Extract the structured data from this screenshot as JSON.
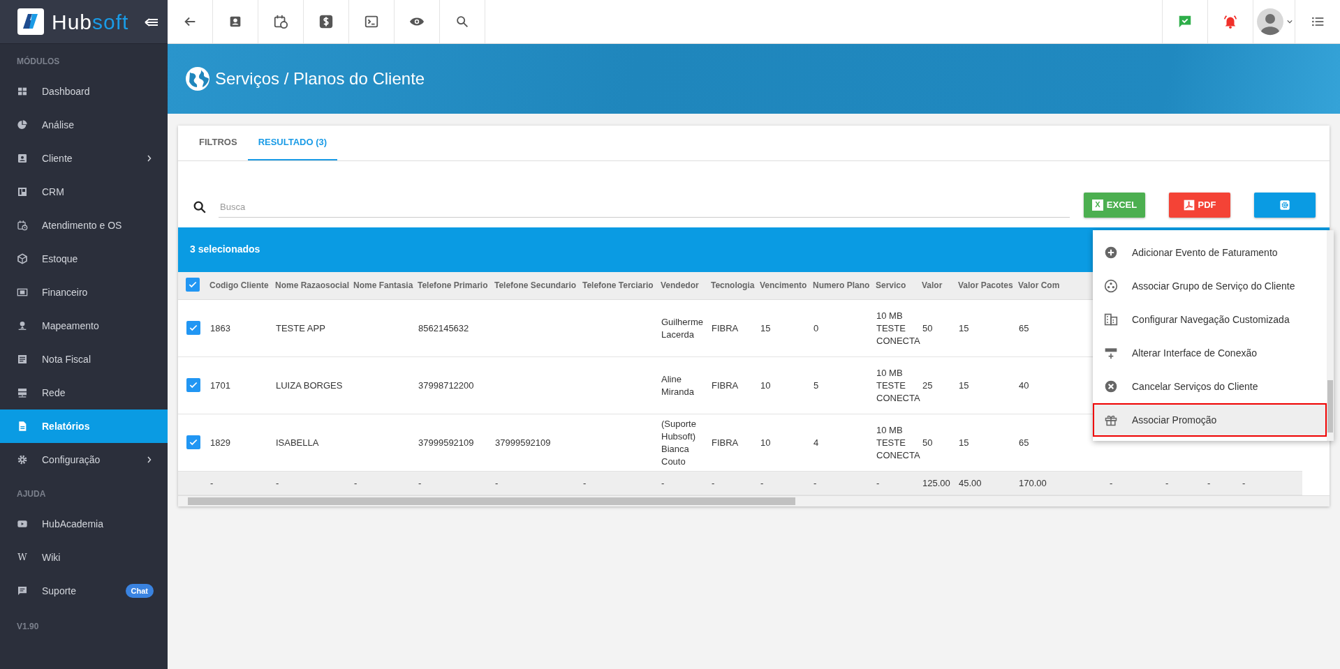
{
  "sidebar": {
    "logo": {
      "text_1": "Hub",
      "text_2": "soft"
    },
    "sections": [
      {
        "heading": "MÓDULOS",
        "items": [
          {
            "label": "Dashboard",
            "selected": false,
            "has_submenu": false
          },
          {
            "label": "Análise",
            "selected": false,
            "has_submenu": false
          },
          {
            "label": "Cliente",
            "selected": false,
            "has_submenu": true
          },
          {
            "label": "CRM",
            "selected": false,
            "has_submenu": false
          },
          {
            "label": "Atendimento e OS",
            "selected": false,
            "has_submenu": false
          },
          {
            "label": "Estoque",
            "selected": false,
            "has_submenu": false
          },
          {
            "label": "Financeiro",
            "selected": false,
            "has_submenu": false
          },
          {
            "label": "Mapeamento",
            "selected": false,
            "has_submenu": false
          },
          {
            "label": "Nota Fiscal",
            "selected": false,
            "has_submenu": false
          },
          {
            "label": "Rede",
            "selected": false,
            "has_submenu": false
          },
          {
            "label": "Relatórios",
            "selected": true,
            "has_submenu": false
          },
          {
            "label": "Configuração",
            "selected": false,
            "has_submenu": true
          }
        ]
      },
      {
        "heading": "AJUDA",
        "items": [
          {
            "label": "HubAcademia",
            "selected": false,
            "has_submenu": false
          },
          {
            "label": "Wiki",
            "selected": false,
            "has_submenu": false,
            "icon_glyph": "W"
          },
          {
            "label": "Suporte",
            "selected": false,
            "has_submenu": false,
            "badge": "Chat"
          }
        ]
      }
    ],
    "version": "V1.90"
  },
  "page_header": {
    "title": "Serviços / Planos do Cliente"
  },
  "tabs": [
    {
      "label": "FILTROS",
      "selected": false
    },
    {
      "label": "RESULTADO (3)",
      "selected": true
    }
  ],
  "search": {
    "placeholder": "Busca"
  },
  "export_buttons": [
    {
      "kind": "excel",
      "label": "EXCEL",
      "icon_glyph": "X"
    },
    {
      "kind": "pdf",
      "label": "PDF"
    },
    {
      "kind": "settings"
    }
  ],
  "selection_bar": {
    "text": "3 selecionados"
  },
  "table": {
    "select_all_checked": true,
    "columns": [
      "Codigo Cliente",
      "Nome Razaosocial",
      "Nome Fantasia",
      "Telefone Primario",
      "Telefone Secundario",
      "Telefone Terciario",
      "Vendedor",
      "Tecnologia",
      "Vencimento",
      "Numero Plano",
      "Servico",
      "Valor",
      "Valor Pacotes",
      "Valor Com",
      "",
      "",
      "",
      ""
    ],
    "rows": [
      {
        "checked": true,
        "cells": [
          "1863",
          "TESTE APP",
          "",
          "8562145632",
          "",
          "",
          "Guilherme Lacerda",
          "FIBRA",
          "15",
          "0",
          "10 MB TESTE CONECTA",
          "50",
          "15",
          "65",
          "",
          "",
          "",
          ""
        ]
      },
      {
        "checked": true,
        "cells": [
          "1701",
          "LUIZA BORGES",
          "",
          "37998712200",
          "",
          "",
          "Aline Miranda",
          "FIBRA",
          "10",
          "5",
          "10 MB TESTE CONECTA",
          "25",
          "15",
          "40",
          "",
          "",
          "",
          ""
        ]
      },
      {
        "checked": true,
        "cells": [
          "1829",
          "ISABELLA",
          "",
          "37999592109",
          "37999592109",
          "",
          "(Suporte Hubsoft) Bianca Couto",
          "FIBRA",
          "10",
          "4",
          "10 MB TESTE CONECTA",
          "50",
          "15",
          "65",
          "",
          "",
          "",
          ""
        ]
      }
    ],
    "footer": [
      "-",
      "-",
      "-",
      "-",
      "-",
      "-",
      "-",
      "-",
      "-",
      "-",
      "-",
      "125.00",
      "45.00",
      "170.00",
      "-",
      "-",
      "-",
      "-"
    ]
  },
  "action_menu": {
    "items": [
      {
        "label": "Adicionar Evento de Faturamento",
        "selected": false
      },
      {
        "label": "Associar Grupo de Serviço do Cliente",
        "selected": false
      },
      {
        "label": "Configurar Navegação Customizada",
        "selected": false
      },
      {
        "label": "Alterar Interface de Conexão",
        "selected": false
      },
      {
        "label": "Cancelar Serviços do Cliente",
        "selected": false
      },
      {
        "label": "Associar Promoção",
        "selected": true
      }
    ]
  }
}
